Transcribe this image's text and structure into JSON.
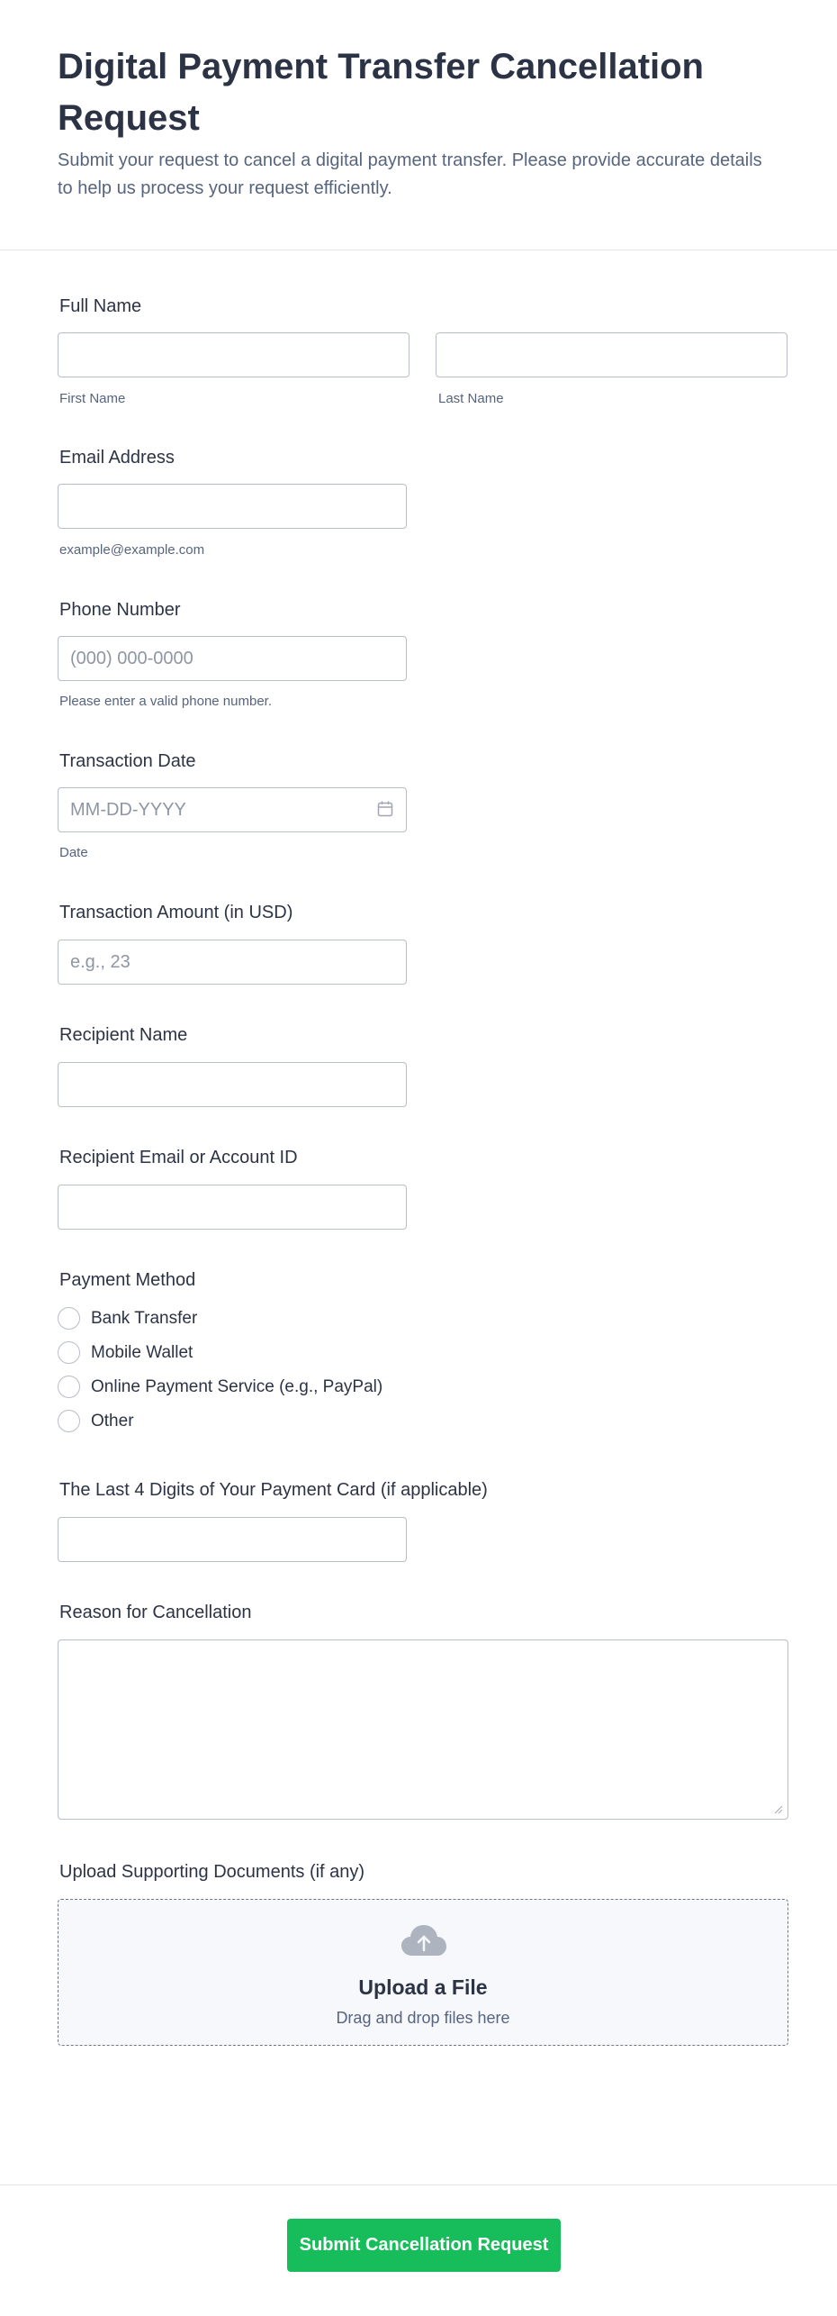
{
  "header": {
    "title": "Digital Payment Transfer Cancellation Request",
    "subtitle": "Submit your request to cancel a digital payment transfer. Please provide accurate details to help us process your request efficiently."
  },
  "fields": {
    "full_name": {
      "label": "Full Name",
      "first_sublabel": "First Name",
      "last_sublabel": "Last Name",
      "first_value": "",
      "last_value": ""
    },
    "email": {
      "label": "Email Address",
      "sublabel": "example@example.com",
      "value": ""
    },
    "phone": {
      "label": "Phone Number",
      "placeholder": "(000) 000-0000",
      "sublabel": "Please enter a valid phone number.",
      "value": ""
    },
    "transaction_date": {
      "label": "Transaction Date",
      "placeholder": "MM-DD-YYYY",
      "sublabel": "Date",
      "icon": "calendar-icon"
    },
    "transaction_amount": {
      "label": "Transaction Amount (in USD)",
      "placeholder": "e.g., 23"
    },
    "recipient_name": {
      "label": "Recipient Name"
    },
    "recipient_email": {
      "label": "Recipient Email or Account ID"
    },
    "payment_method": {
      "label": "Payment Method",
      "options": [
        "Bank Transfer",
        "Mobile Wallet",
        "Online Payment Service (e.g., PayPal)",
        "Other"
      ],
      "selected": null
    },
    "card_last4": {
      "label": "The Last 4 Digits of Your Payment Card (if applicable)"
    },
    "reason": {
      "label": "Reason for Cancellation"
    },
    "upload": {
      "label": "Upload Supporting Documents (if any)",
      "title": "Upload a File",
      "subtitle": "Drag and drop files here",
      "icon": "cloud-upload-icon"
    }
  },
  "footer": {
    "submit_label": "Submit Cancellation Request"
  },
  "colors": {
    "accent": "#18bd5b",
    "text": "#2c3345",
    "muted": "#57647e",
    "border": "#b8bdc9"
  }
}
